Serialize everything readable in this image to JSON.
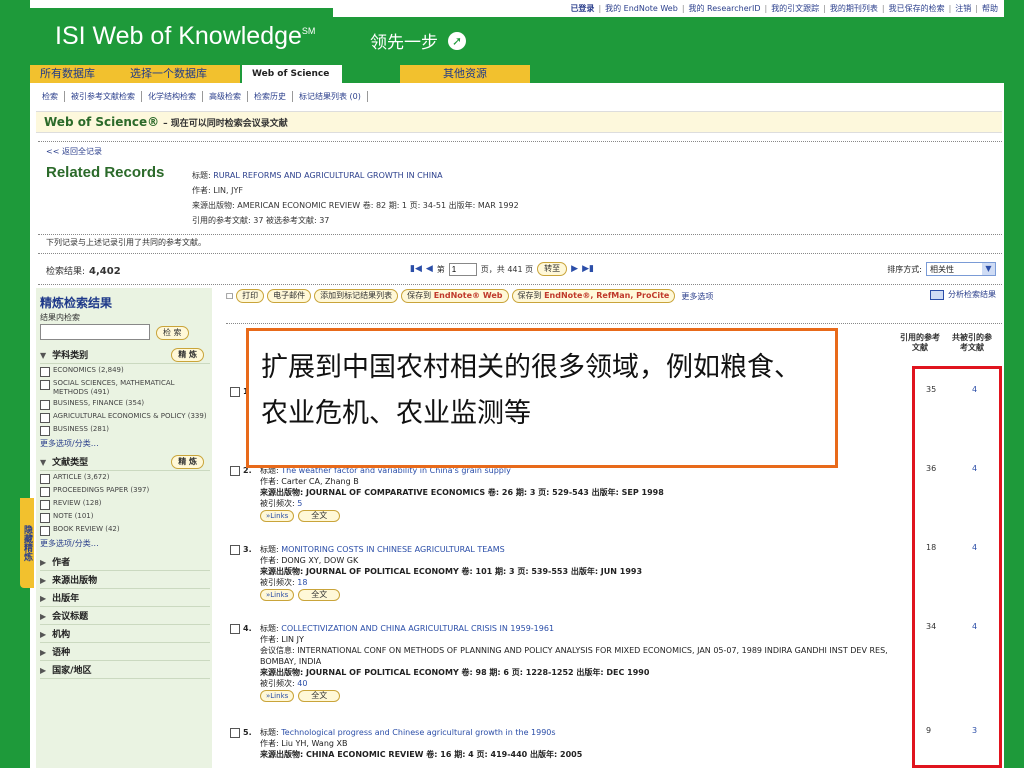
{
  "top_links": [
    "已登录",
    "我的 EndNote Web",
    "我的 ResearcherID",
    "我的引文跟踪",
    "我的期刊列表",
    "我已保存的检索",
    "注销",
    "帮助"
  ],
  "brand": {
    "name": "ISI Web of Knowledge",
    "mark": "SM",
    "slogan": "领先一步"
  },
  "tabs": [
    "所有数据库",
    "选择一个数据库",
    "Web of Science",
    "其他资源"
  ],
  "subnav": [
    "检索",
    "被引参考文献检索",
    "化学结构检索",
    "高级检索",
    "检索历史",
    "标记结果列表 (0)"
  ],
  "title_bar": {
    "main": "Web of Science®",
    "sub": "– 现在可以同时检索会议录文献"
  },
  "back_link": "<< 返回全记录",
  "related_title": "Related Records",
  "source_record": {
    "title_label": "标题:",
    "title": "RURAL REFORMS AND AGRICULTURAL GROWTH IN CHINA",
    "author": "作者: LIN, JYF",
    "source": "来源出版物: AMERICAN ECONOMIC REVIEW 卷: 82 期: 1 页: 34-51 出版年: MAR 1992",
    "refs": "引用的参考文献: 37 被选参考文献: 37"
  },
  "note": "下列记录与上述记录引用了共同的参考文献。",
  "results": {
    "label": "检索结果:",
    "count": "4,402"
  },
  "pager": {
    "prefix": "第",
    "page": "1",
    "suffix": "页，共 441 页",
    "go": "转至"
  },
  "sort": {
    "label": "排序方式:",
    "value": "相关性"
  },
  "toolbar": {
    "print": "打印",
    "email": "电子邮件",
    "add_marked": "添加到标记结果列表",
    "save_endnote_pre": "保存到",
    "save_endnote_brand": "EndNote® Web",
    "save_ref_pre": "保存到",
    "save_ref_brand": "EndNote®, RefMan, ProCite",
    "more": "更多选项",
    "analyze": "分析检索结果"
  },
  "sidebar": {
    "tab": "隐藏精炼",
    "title": "精炼检索结果",
    "sub": "结果内检索",
    "go": "检 索",
    "refine": "精 炼",
    "subject_label": "学科类别",
    "subjects": [
      "ECONOMICS (2,849)",
      "SOCIAL SCIENCES, MATHEMATICAL METHODS (491)",
      "BUSINESS, FINANCE (354)",
      "AGRICULTURAL ECONOMICS & POLICY (339)",
      "BUSINESS (281)"
    ],
    "more": "更多选项/分类…",
    "doctype_label": "文献类型",
    "doctypes": [
      "ARTICLE (3,672)",
      "PROCEEDINGS PAPER (397)",
      "REVIEW (128)",
      "NOTE (101)",
      "BOOK REVIEW (42)"
    ],
    "sections": [
      "作者",
      "来源出版物",
      "出版年",
      "会议标题",
      "机构",
      "语种",
      "国家/地区"
    ]
  },
  "columns": {
    "cited": "引用的参考文献",
    "shared": "共被引的参考文献"
  },
  "records": [
    {
      "num": "1.",
      "title": "",
      "author": "",
      "source": "",
      "extra": "",
      "citations": "",
      "cited": "35",
      "shared": "4"
    },
    {
      "num": "2.",
      "title": "The weather factor and variability in China's grain supply",
      "author": "作者: Carter CA, Zhang B",
      "source": "来源出版物: JOURNAL OF COMPARATIVE ECONOMICS 卷: 26 期: 3 页: 529-543 出版年: SEP 1998",
      "extra": "",
      "citations": "5",
      "cited": "36",
      "shared": "4"
    },
    {
      "num": "3.",
      "title": "MONITORING COSTS IN CHINESE AGRICULTURAL TEAMS",
      "author": "作者: DONG XY, DOW GK",
      "source": "来源出版物: JOURNAL OF POLITICAL ECONOMY 卷: 101 期: 3 页: 539-553 出版年: JUN 1993",
      "extra": "",
      "citations": "18",
      "cited": "18",
      "shared": "4"
    },
    {
      "num": "4.",
      "title": "COLLECTIVIZATION AND CHINA AGRICULTURAL CRISIS IN 1959-1961",
      "author": "作者: LIN JY",
      "source": "来源出版物: JOURNAL OF POLITICAL ECONOMY 卷: 98 期: 6 页: 1228-1252 出版年: DEC 1990",
      "extra": "会议信息: INTERNATIONAL CONF ON METHODS OF PLANNING AND POLICY ANALYSIS FOR MIXED ECONOMICS, JAN 05-07, 1989 INDIRA GANDHI INST DEV RES, BOMBAY, INDIA",
      "citations": "40",
      "cited": "34",
      "shared": "4"
    },
    {
      "num": "5.",
      "title": "Technological progress and Chinese agricultural growth in the 1990s",
      "author": "作者: Liu YH, Wang XB",
      "source": "来源出版物: CHINA ECONOMIC REVIEW 卷: 16 期: 4 页: 419-440 出版年: 2005",
      "extra": "",
      "citations": "",
      "cited": "9",
      "shared": "3"
    }
  ],
  "labels": {
    "title": "标题:",
    "times_cited": "被引频次:",
    "links": "»Links",
    "fulltext": "全文"
  },
  "annotation": "扩展到中国农村相关的很多领域，例如粮食、农业危机、农业监测等"
}
